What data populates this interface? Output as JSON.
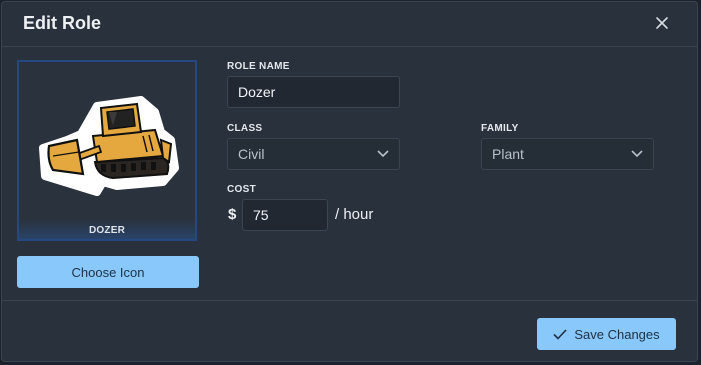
{
  "dialog": {
    "title": "Edit Role"
  },
  "icon_preview": {
    "caption": "DOZER",
    "icon": "bulldozer-icon"
  },
  "choose_icon_label": "Choose Icon",
  "form": {
    "role_name": {
      "label": "ROLE NAME",
      "value": "Dozer"
    },
    "class": {
      "label": "CLASS",
      "value": "Civil"
    },
    "family": {
      "label": "FAMILY",
      "value": "Plant"
    },
    "cost": {
      "label": "COST",
      "currency": "$",
      "value": "75",
      "unit": "/ hour"
    }
  },
  "save_label": "Save Changes",
  "colors": {
    "accent": "#88c8fb",
    "panel": "#29313c",
    "input_bg": "#212831"
  }
}
